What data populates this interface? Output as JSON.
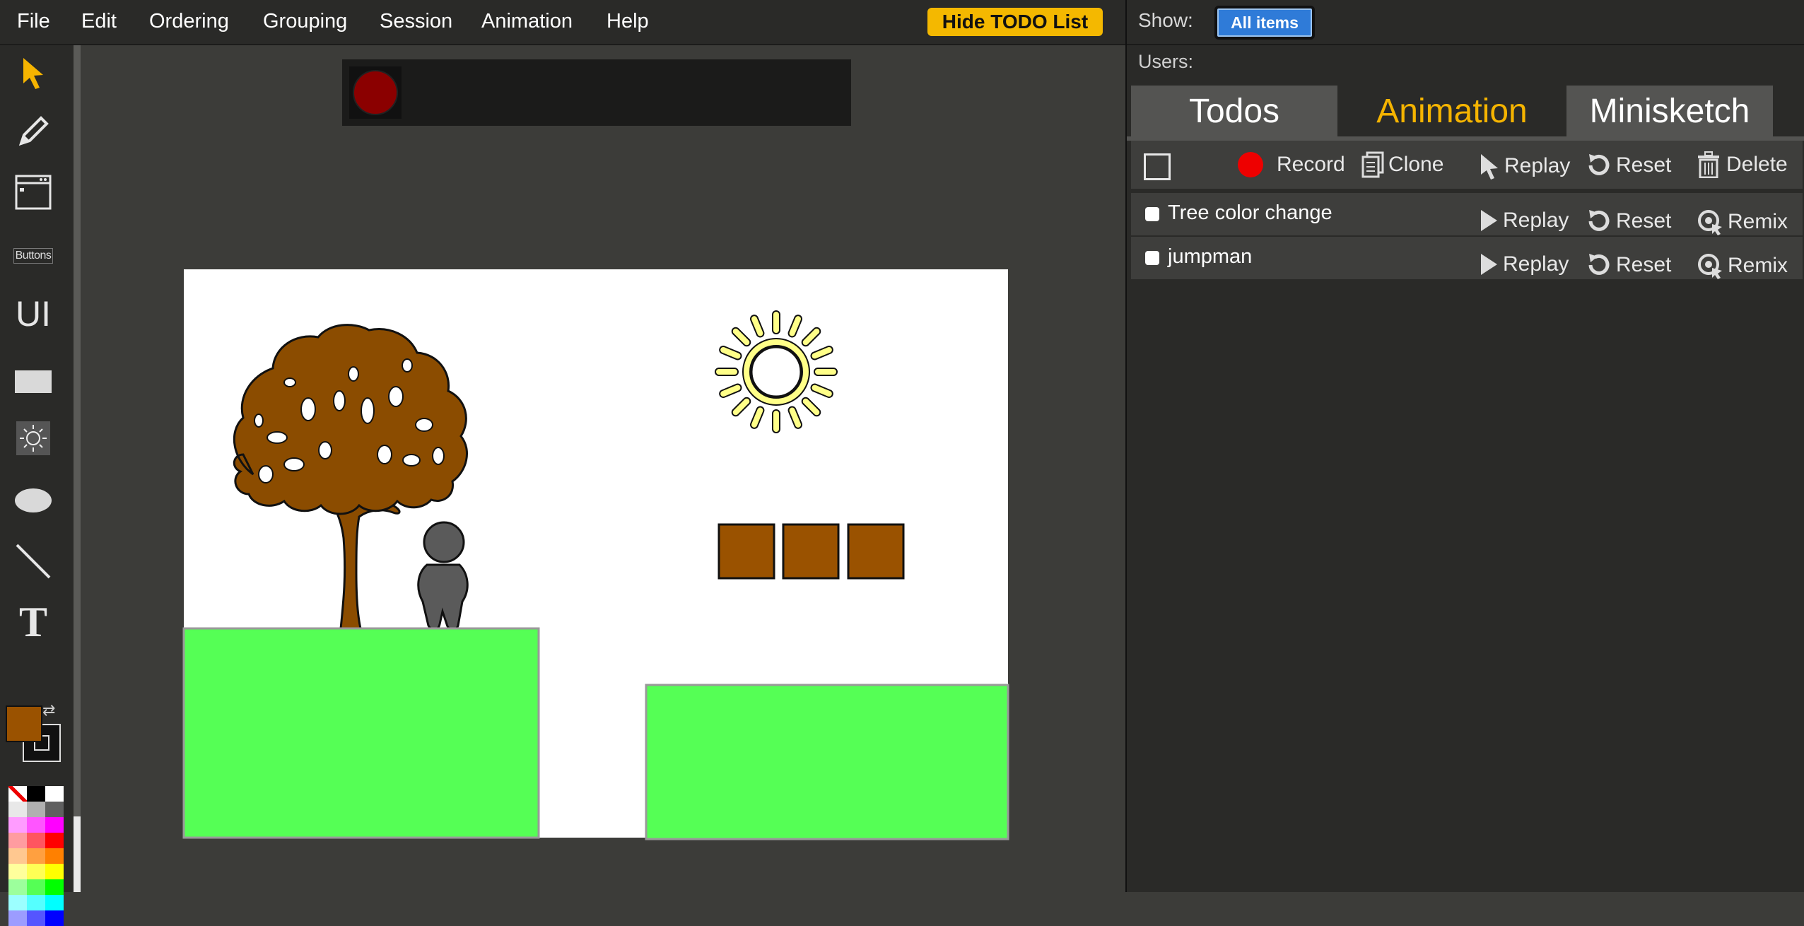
{
  "menu": {
    "items": [
      "File",
      "Edit",
      "Ordering",
      "Grouping",
      "Session",
      "Animation",
      "Help"
    ],
    "hide_todo_label": "Hide TODO List"
  },
  "toolbar": {
    "tools": [
      "pointer",
      "pencil",
      "window",
      "Buttons",
      "UI",
      "rectangle",
      "image",
      "ellipse",
      "line",
      "T"
    ],
    "buttons_label": "Buttons",
    "ui_label": "UI",
    "text_label": "T",
    "fill_color": "#9a5200",
    "stroke_color": "#111111",
    "palette": [
      "none",
      "#000000",
      "#ffffff",
      "#e8e8e8",
      "#b0b0b0",
      "#606060",
      "#ff9cff",
      "#ff55ff",
      "#ff00ff",
      "#ff9ca0",
      "#ff5560",
      "#ff0000",
      "#ffc890",
      "#ffa040",
      "#ff8000",
      "#ffff9c",
      "#ffff55",
      "#ffff00",
      "#9cff9c",
      "#55ff55",
      "#00ff00",
      "#9cffff",
      "#55ffff",
      "#00ffff",
      "#9c9cff",
      "#5555ff",
      "#0000ff"
    ]
  },
  "canvas": {
    "ground_color": "#55ff55",
    "block_color": "#9a5200",
    "tree_color": "#8b4c00",
    "sun_color": "#ffff88",
    "figure_color": "#5a5a5a"
  },
  "panel": {
    "show_label": "Show:",
    "show_value": "All items",
    "users_label": "Users:",
    "tabs": [
      "Todos",
      "Animation",
      "Minisketch"
    ],
    "active_tab": "Animation",
    "controls": {
      "record": "Record",
      "clone": "Clone",
      "replay": "Replay",
      "reset": "Reset",
      "delete": "Delete"
    },
    "animations": [
      {
        "name": "Tree color change",
        "replay": "Replay",
        "reset": "Reset",
        "remix": "Remix"
      },
      {
        "name": "jumpman",
        "replay": "Replay",
        "reset": "Reset",
        "remix": "Remix"
      }
    ]
  }
}
